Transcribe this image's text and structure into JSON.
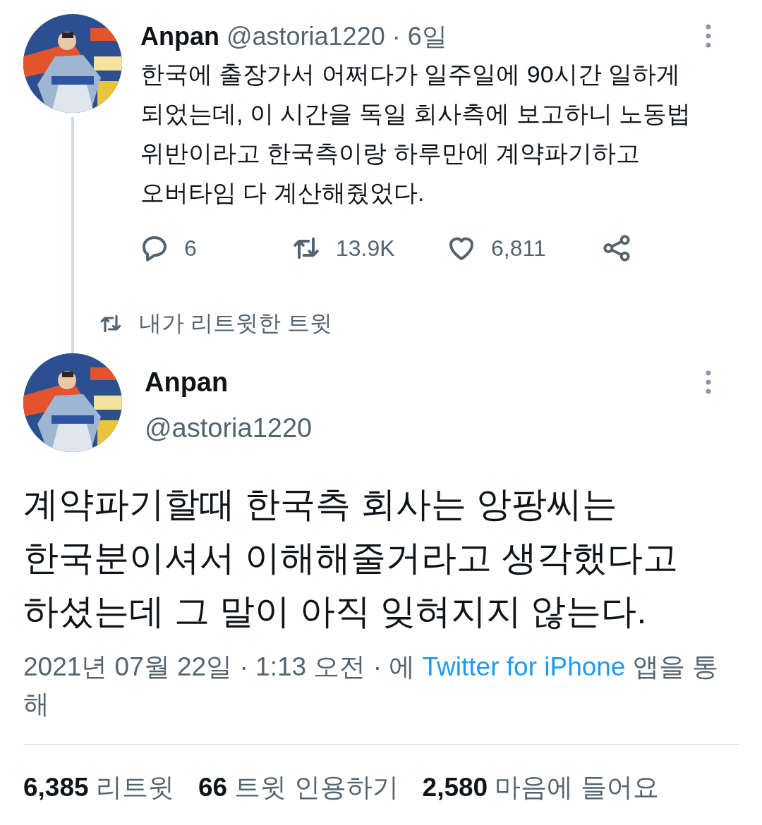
{
  "parent_tweet": {
    "name": "Anpan",
    "handle": "@astoria1220",
    "time": "· 6일",
    "lines": [
      "한국에 출장가서 어쩌다가 일주일에 90시간 일하게",
      "되었는데, 이 시간을 독일 회사측에 보고하니 노동법",
      "위반이라고 한국측이랑 하루만에 계약파기하고",
      "오버타임 다 계산해줬었다."
    ],
    "actions": [
      {
        "kind": "reply",
        "count": "6"
      },
      {
        "kind": "retweet",
        "count": "13.9K"
      },
      {
        "kind": "like",
        "count": "6,811"
      },
      {
        "kind": "share"
      }
    ]
  },
  "retweet_label": "내가 리트윗한 트윗",
  "main_tweet": {
    "name": "Anpan",
    "handle": "@astoria1220",
    "lines": [
      "계약파기할때 한국측 회사는 앙팡씨는",
      "한국분이셔서 이해해줄거라고 생각했다고",
      "하셨는데 그 말이 아직 잊혀지지 않는다."
    ],
    "date": "2021년 07월 22일 · 1:13 오전 · 에",
    "source_link": "Twitter for iPhone",
    "source_suffix": "앱을 통해"
  },
  "stats": [
    {
      "count": "6,385",
      "label": "리트윗"
    },
    {
      "count": "66",
      "label": "트윗 인용하기"
    },
    {
      "count": "2,580",
      "label": "마음에 들어요"
    }
  ]
}
